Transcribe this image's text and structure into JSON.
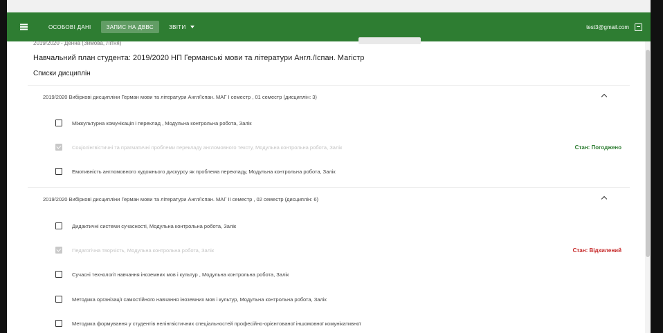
{
  "appbar": {
    "nav": [
      "Особові дані",
      "Запис на ДВВС",
      "Звіти"
    ],
    "user_email": "test3@gmail.com"
  },
  "partial_text": "2019/2020 - Денна (Зимова, Літня)",
  "plan_title": "Навчальний план студента: 2019/2020 НП Германські мови та літератури Англ./Іспан. Магістр",
  "lists_title": "Списки дисциплін",
  "sections": [
    {
      "title": "2019/2020 Вибіркові дисципліни Герман мови та літератури Англ/Іспан. МАГ I семестр , 01 семестр (дисциплін: 3)",
      "items": [
        {
          "label": "Міжкультурна комунікація і переклад , Модульна контрольна робота, Залік",
          "checked": false,
          "disabled": false,
          "status": ""
        },
        {
          "label": "Соціолінгвістичні та прагматичні проблеми перекладу англомовного тексту, Модульна контрольна робота, Залік",
          "checked": true,
          "disabled": true,
          "status": "Стан: Погоджено"
        },
        {
          "label": "Емотивність англомовного художнього дискурсу як проблема перекладу, Модульна контрольна робота, Залік",
          "checked": false,
          "disabled": false,
          "status": ""
        }
      ]
    },
    {
      "title": "2019/2020 Вибіркові дисципліни Герман мови та літератури Англ/Іспан. МАГ II семестр , 02 семестр (дисциплін: 6)",
      "items": [
        {
          "label": "Дидактичні системи сучасності, Модульна контрольна робота, Залік",
          "checked": false,
          "disabled": false,
          "status": ""
        },
        {
          "label": "Педагогічна творчість, Модульна контрольна робота, Залік",
          "checked": true,
          "disabled": true,
          "status": "Стан: Відхилений"
        },
        {
          "label": "Сучасні технології навчання іноземних мов і культур , Модульна контрольна робота, Залік",
          "checked": false,
          "disabled": false,
          "status": ""
        },
        {
          "label": "Методика організації самостійного навчання іноземних мов і культур, Модульна контрольна робота, Залік",
          "checked": false,
          "disabled": false,
          "status": ""
        },
        {
          "label": "Методика формування у студентів нелінгвістичних спеціальностей професійно-орієнтованої іншомовної комунікативної",
          "checked": false,
          "disabled": false,
          "status": ""
        }
      ]
    }
  ],
  "colors": {
    "appbar": "#2e7d32",
    "status_ok": "#2e7d32",
    "status_bad": "#c62828"
  }
}
